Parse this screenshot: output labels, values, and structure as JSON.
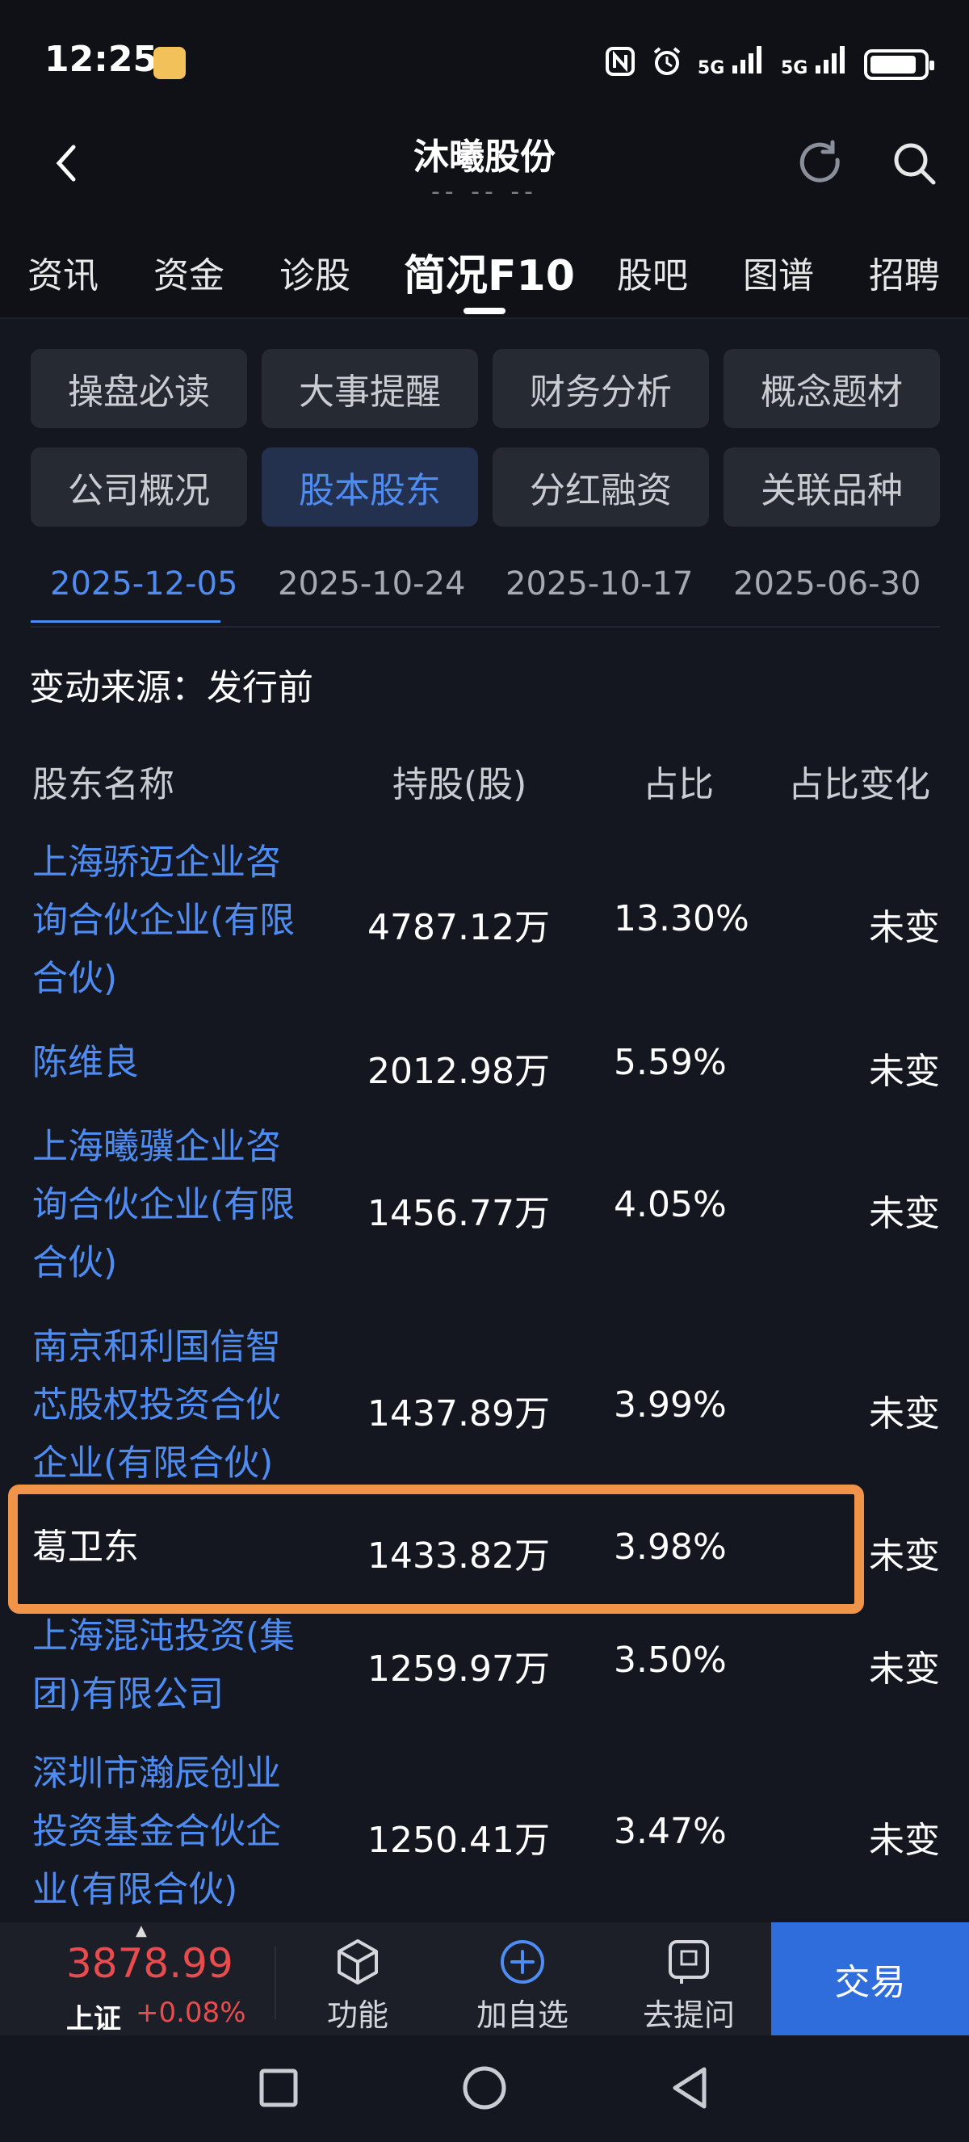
{
  "status_bar": {
    "time": "12:25",
    "signal1": "5G",
    "signal2": "5G"
  },
  "header": {
    "title": "沐曦股份",
    "subtitle": "-- -- --"
  },
  "top_tabs": [
    {
      "label": "资讯"
    },
    {
      "label": "资金"
    },
    {
      "label": "诊股"
    },
    {
      "label": "简况F10",
      "active": true
    },
    {
      "label": "股吧"
    },
    {
      "label": "图谱"
    },
    {
      "label": "招聘"
    }
  ],
  "chips": [
    {
      "label": "操盘必读"
    },
    {
      "label": "大事提醒"
    },
    {
      "label": "财务分析"
    },
    {
      "label": "概念题材"
    },
    {
      "label": "公司概况"
    },
    {
      "label": "股本股东",
      "active": true
    },
    {
      "label": "分红融资"
    },
    {
      "label": "关联品种"
    }
  ],
  "date_tabs": [
    {
      "label": "2025-12-05",
      "active": true
    },
    {
      "label": "2025-10-24"
    },
    {
      "label": "2025-10-17"
    },
    {
      "label": "2025-06-30"
    }
  ],
  "change_source": "变动来源：发行前",
  "table": {
    "headers": [
      "股东名称",
      "持股(股)",
      "占比",
      "占比变化"
    ],
    "rows": [
      {
        "name": "上海骄迈企业咨询合伙企业(有限合伙)",
        "lines": [
          "上海骄迈企业咨",
          "询合伙企业(有限",
          "合伙)"
        ],
        "shares": "4787.12万",
        "ratio": "13.30%",
        "change": "未变"
      },
      {
        "name": "陈维良",
        "lines": [
          "陈维良"
        ],
        "shares": "2012.98万",
        "ratio": "5.59%",
        "change": "未变"
      },
      {
        "name": "上海曦骥企业咨询合伙企业(有限合伙)",
        "lines": [
          "上海曦骥企业咨",
          "询合伙企业(有限",
          "合伙)"
        ],
        "shares": "1456.77万",
        "ratio": "4.05%",
        "change": "未变"
      },
      {
        "name": "南京和利国信智芯股权投资合伙企业(有限合伙)",
        "lines": [
          "南京和利国信智",
          "芯股权投资合伙",
          "企业(有限合伙)"
        ],
        "shares": "1437.89万",
        "ratio": "3.99%",
        "change": "未变"
      },
      {
        "name": "葛卫东",
        "lines": [
          "葛卫东"
        ],
        "shares": "1433.82万",
        "ratio": "3.98%",
        "change": "未变"
      },
      {
        "name": "上海混沌投资(集团)有限公司",
        "lines": [
          "上海混沌投资(集",
          "团)有限公司"
        ],
        "shares": "1259.97万",
        "ratio": "3.50%",
        "change": "未变"
      },
      {
        "name": "深圳市瀚辰创业投资基金合伙企业(有限合伙)",
        "lines": [
          "深圳市瀚辰创业",
          "投资基金合伙企",
          "业(有限合伙)"
        ],
        "shares": "1250.41万",
        "ratio": "3.47%",
        "change": "未变"
      }
    ]
  },
  "bottom_bar": {
    "index_value": "3878.99",
    "index_name": "上证",
    "index_change": "+0.08%",
    "tools": [
      {
        "label": "功能",
        "icon": "cube-icon"
      },
      {
        "label": "加自选",
        "icon": "add-circle-icon"
      },
      {
        "label": "去提问",
        "icon": "question-chat-icon"
      }
    ],
    "trade_label": "交易"
  },
  "colors": {
    "accent": "#4f8cf2",
    "highlight": "#f0944a",
    "up": "#e84c4c",
    "trade": "#2f6ddc"
  }
}
